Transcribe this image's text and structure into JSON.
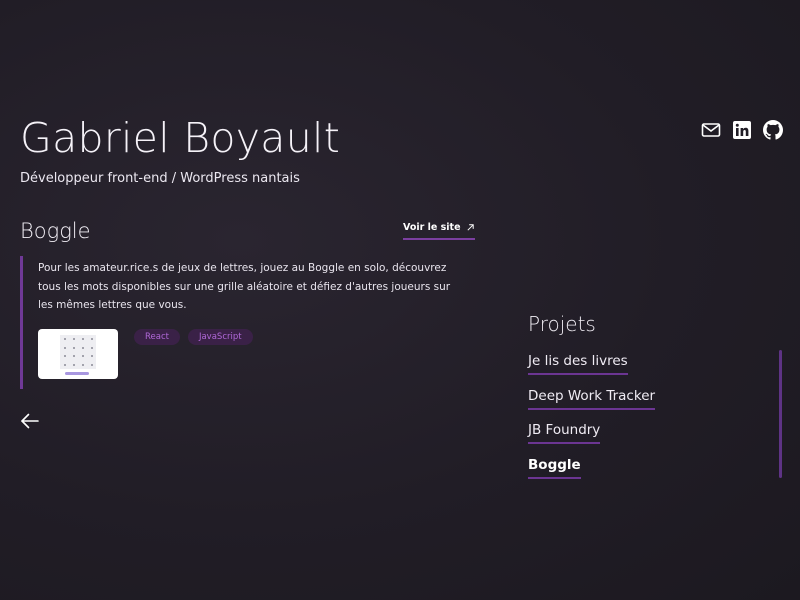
{
  "header": {
    "name": "Gabriel Boyault",
    "subtitle": "Développeur front-end / WordPress nantais"
  },
  "social": [
    {
      "icon": "mail-icon"
    },
    {
      "icon": "linkedin-icon"
    },
    {
      "icon": "github-icon"
    }
  ],
  "project": {
    "title": "Boggle",
    "visit_label": "Voir le site",
    "description": "Pour les amateur.rice.s de jeux de lettres, jouez au Boggle en solo, découvrez tous les mots disponibles sur une grille aléatoire et défiez d'autres joueurs sur les mêmes lettres que vous.",
    "tags": [
      "React",
      "JavaScript"
    ]
  },
  "projects_nav": {
    "heading": "Projets",
    "items": [
      {
        "label": "Je lis des livres",
        "active": false
      },
      {
        "label": "Deep Work Tracker",
        "active": false
      },
      {
        "label": "JB Foundry",
        "active": false
      },
      {
        "label": "Boggle",
        "active": true
      }
    ]
  },
  "colors": {
    "background": "#211d26",
    "accent": "#6f3996",
    "tag_text": "#b068d8",
    "tag_background": "#3a2147"
  }
}
